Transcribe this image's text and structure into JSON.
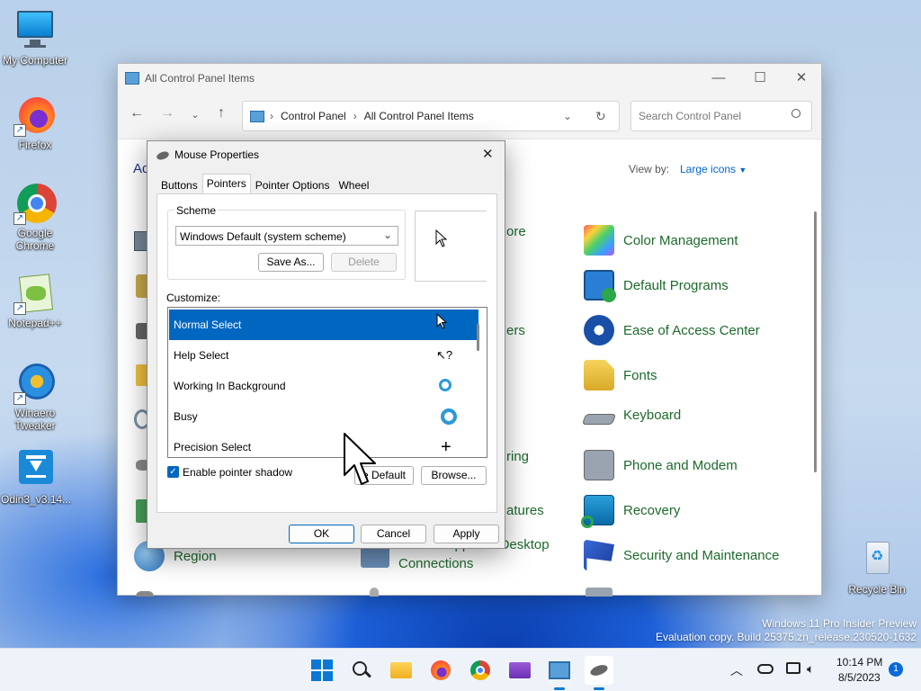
{
  "desktop": {
    "icons": [
      {
        "label": "My Computer"
      },
      {
        "label": "Firefox"
      },
      {
        "label": "Google Chrome"
      },
      {
        "label": "Notepad++"
      },
      {
        "label": "Winaero Tweaker"
      },
      {
        "label": "Odin3_v3.14..."
      },
      {
        "label": "Recycle Bin"
      }
    ],
    "watermark_line1": "Windows 11 Pro Insider Preview",
    "watermark_line2": "Evaluation copy. Build 25375.zn_release.230520-1632"
  },
  "control_panel": {
    "title": "All Control Panel Items",
    "breadcrumb": [
      "Control Panel",
      "All Control Panel Items"
    ],
    "search_placeholder": "Search Control Panel",
    "heading_partial": "Ad",
    "view_by_label": "View by:",
    "view_by_value": "Large icons",
    "left_items": [
      "Region"
    ],
    "middle_partial": [
      "ore",
      "ers",
      "ring",
      "atures"
    ],
    "middle_item": {
      "line1": "RemoteApp and Desktop",
      "line2": "Connections"
    },
    "right_items": [
      "Color Management",
      "Default Programs",
      "Ease of Access Center",
      "Fonts",
      "Keyboard",
      "Phone and Modem",
      "Recovery",
      "Security and Maintenance"
    ]
  },
  "dialog": {
    "title": "Mouse Properties",
    "tabs": [
      "Buttons",
      "Pointers",
      "Pointer Options",
      "Wheel"
    ],
    "scheme_label": "Scheme",
    "scheme_value": "Windows Default (system scheme)",
    "save_as": "Save As...",
    "delete": "Delete",
    "customize_label": "Customize:",
    "pointer_rows": [
      "Normal Select",
      "Help Select",
      "Working In Background",
      "Busy",
      "Precision Select"
    ],
    "shadow_label": "Enable pointer shadow",
    "use_default_partial": "e Default",
    "browse": "Browse...",
    "ok": "OK",
    "cancel": "Cancel",
    "apply": "Apply"
  },
  "taskbar": {
    "time": "10:14 PM",
    "date": "8/5/2023",
    "notification_count": "1"
  }
}
